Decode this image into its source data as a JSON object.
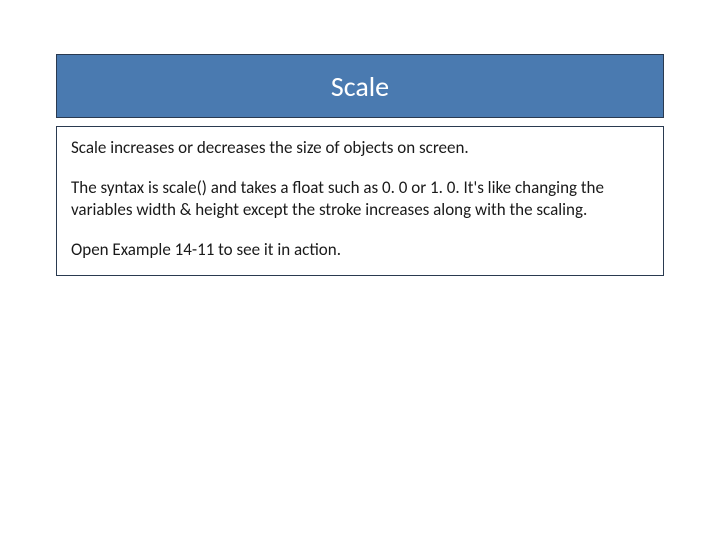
{
  "title": "Scale",
  "paragraphs": {
    "p1": "Scale increases or decreases the size of objects on screen.",
    "p2": "The syntax is scale() and takes a float such as 0. 0 or 1. 0.  It's like changing the variables width & height except the stroke increases along with the scaling.",
    "p3": "Open Example 14-11 to see it in action."
  },
  "colors": {
    "title_bg": "#4a7ab0",
    "border": "#2a3a50",
    "text": "#1a1a1a",
    "title_text": "#ffffff"
  }
}
